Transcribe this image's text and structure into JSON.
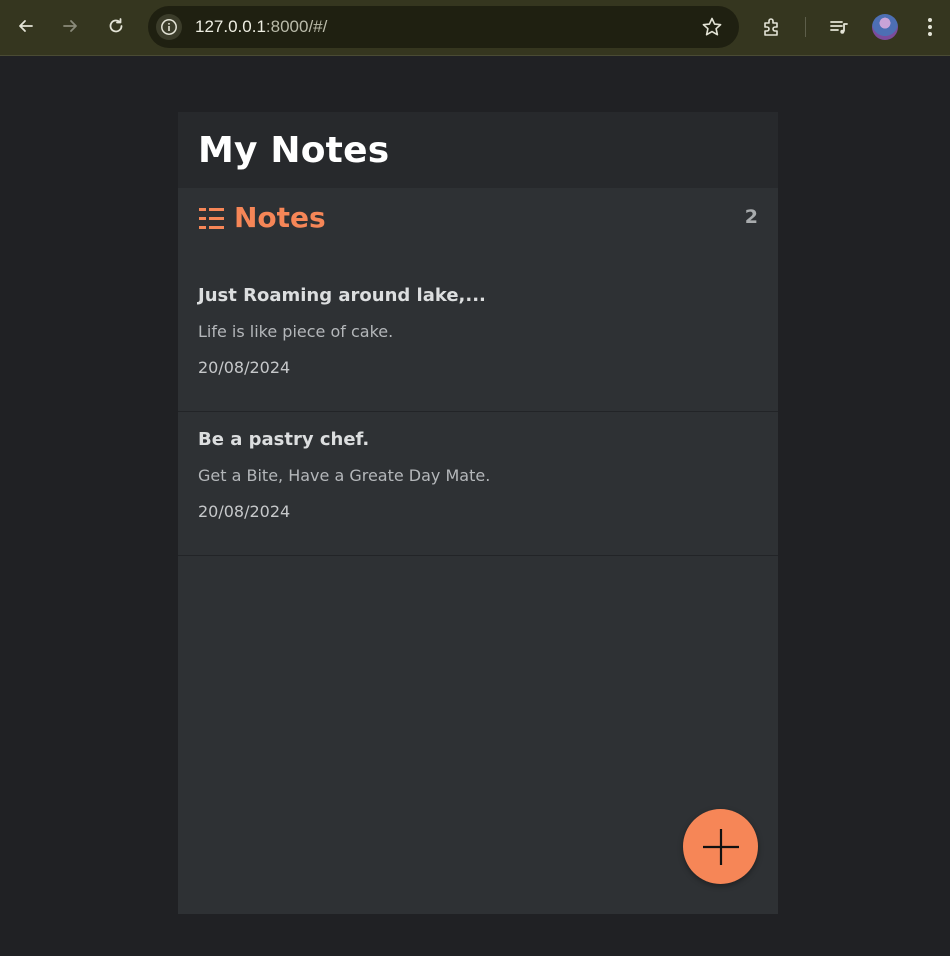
{
  "browser": {
    "url_host": "127.0.0.1",
    "url_rest": ":8000/#/"
  },
  "app": {
    "title": "My Notes",
    "section_title": "Notes",
    "note_count": "2",
    "accent_color": "#f68657",
    "notes": [
      {
        "title": "Just Roaming around lake,...",
        "body": "Life is like piece of cake.",
        "date": "20/08/2024"
      },
      {
        "title": "Be a pastry chef.",
        "body": "Get a Bite, Have a Greate Day Mate.",
        "date": "20/08/2024"
      }
    ],
    "fab_icon": "plus-icon"
  }
}
